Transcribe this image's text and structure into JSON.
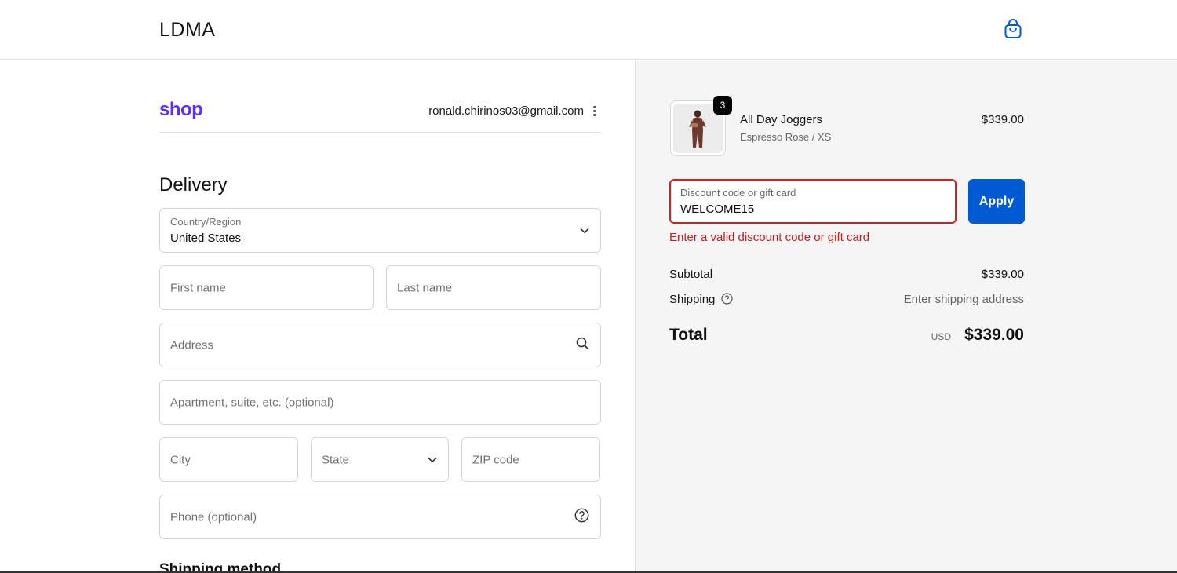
{
  "header": {
    "brand": "LDMA",
    "cart_icon": "shopping-bag-icon"
  },
  "account": {
    "shop_logo": "shop",
    "email": "ronald.chirinos03@gmail.com",
    "menu_icon": "more-vertical-icon"
  },
  "delivery": {
    "title": "Delivery",
    "country": {
      "label": "Country/Region",
      "value": "United States",
      "icon": "chevron-down-icon"
    },
    "first_name": {
      "placeholder": "First name"
    },
    "last_name": {
      "placeholder": "Last name"
    },
    "address": {
      "placeholder": "Address",
      "icon": "search-icon"
    },
    "apartment": {
      "placeholder": "Apartment, suite, etc. (optional)"
    },
    "city": {
      "placeholder": "City"
    },
    "state": {
      "placeholder": "State",
      "icon": "chevron-down-icon"
    },
    "zip": {
      "placeholder": "ZIP code"
    },
    "phone": {
      "placeholder": "Phone (optional)",
      "icon": "help-circle-icon"
    },
    "shipping_method_title": "Shipping method"
  },
  "summary": {
    "item": {
      "name": "All Day Joggers",
      "variant": "Espresso Rose / XS",
      "price": "$339.00",
      "quantity": "3"
    },
    "discount": {
      "label": "Discount code or gift card",
      "value": "WELCOME15",
      "apply_label": "Apply",
      "error": "Enter a valid discount code or gift card"
    },
    "subtotal_label": "Subtotal",
    "subtotal_value": "$339.00",
    "shipping_label": "Shipping",
    "shipping_value": "Enter shipping address",
    "total_label": "Total",
    "currency": "USD",
    "total_value": "$339.00"
  },
  "colors": {
    "shop_purple": "#5a31f4",
    "apply_blue": "#005bd3",
    "error_red": "#dd1d1d",
    "summary_bg": "#f5f5f5"
  }
}
